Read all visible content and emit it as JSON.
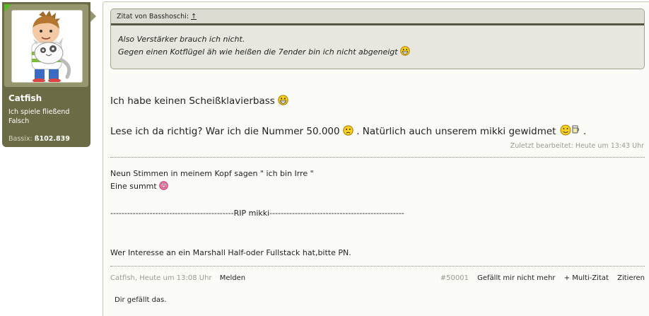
{
  "user": {
    "name": "Catfish",
    "title": "Ich spiele fließend Falsch",
    "stat_label": "Bassix:",
    "stat_value": "ß102.839"
  },
  "quote": {
    "header": "Zitat von Basshoschi:",
    "jump": "↑",
    "line1": "Also Verstärker brauch ich nicht.",
    "line2": "Gegen einen Kotflügel äh wie heißen die 7ender bin ich nicht abgeneigt"
  },
  "post": {
    "line1": "Ich habe keinen Scheißklavierbass",
    "line2a": "Lese ich da richtig? War ich die Nummer 50.000",
    "line2b": ". Natürlich auch unserem mikki gewidmet",
    "line2c": ".",
    "edited": "Zuletzt bearbeitet: Heute um 13:43 Uhr"
  },
  "signature": {
    "line1": "Neun Stimmen in meinem Kopf sagen \" ich bin Irre \"",
    "line2": "Eine summt",
    "rip": "--------------------------------------------RIP mikki------------------------------------------------",
    "ad": "Wer Interesse an ein Marshall Half-oder Fullstack hat,bitte PN."
  },
  "footer": {
    "meta": "Catfish, Heute um 13:08 Uhr",
    "report": "Melden",
    "post_number": "#50001",
    "unlike": "Gefällt mir nicht mehr",
    "multiquote": "+ Multi-Zitat",
    "quote": "Zitieren"
  },
  "likes": {
    "text": "Dir gefällt das."
  }
}
